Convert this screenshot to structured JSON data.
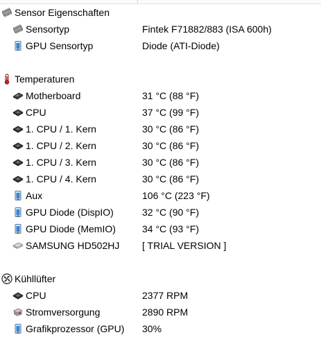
{
  "groups": [
    {
      "title": "Sensor Eigenschaften",
      "icon": "sensor-chip-icon",
      "items": [
        {
          "label": "Sensortyp",
          "value": "Fintek F71882/883  (ISA 600h)",
          "icon": "chip-icon"
        },
        {
          "label": "GPU Sensortyp",
          "value": "Diode  (ATI-Diode)",
          "icon": "gpu-icon"
        }
      ]
    },
    {
      "title": "Temperaturen",
      "icon": "thermometer-icon",
      "items": [
        {
          "label": "Motherboard",
          "value": "31 °C  (88 °F)",
          "icon": "motherboard-icon"
        },
        {
          "label": "CPU",
          "value": "37 °C  (99 °F)",
          "icon": "cpu-icon"
        },
        {
          "label": "1. CPU / 1. Kern",
          "value": "30 °C  (86 °F)",
          "icon": "cpu-icon"
        },
        {
          "label": "1. CPU / 2. Kern",
          "value": "30 °C  (86 °F)",
          "icon": "cpu-icon"
        },
        {
          "label": "1. CPU / 3. Kern",
          "value": "30 °C  (86 °F)",
          "icon": "cpu-icon"
        },
        {
          "label": "1. CPU / 4. Kern",
          "value": "30 °C  (86 °F)",
          "icon": "cpu-icon"
        },
        {
          "label": "Aux",
          "value": "106 °C  (223 °F)",
          "icon": "gpu-icon"
        },
        {
          "label": "GPU Diode (DispIO)",
          "value": "32 °C  (90 °F)",
          "icon": "gpu-icon"
        },
        {
          "label": "GPU Diode (MemIO)",
          "value": "34 °C  (93 °F)",
          "icon": "gpu-icon"
        },
        {
          "label": "SAMSUNG HD502HJ",
          "value": "[ TRIAL VERSION ]",
          "icon": "hard-drive-icon"
        }
      ]
    },
    {
      "title": "Kühllüfter",
      "icon": "fan-icon",
      "items": [
        {
          "label": "CPU",
          "value": "2377 RPM",
          "icon": "cpu-icon"
        },
        {
          "label": "Stromversorgung",
          "value": "2890 RPM",
          "icon": "power-supply-icon"
        },
        {
          "label": "Grafikprozessor (GPU)",
          "value": "30%",
          "icon": "gpu-icon"
        }
      ]
    }
  ]
}
